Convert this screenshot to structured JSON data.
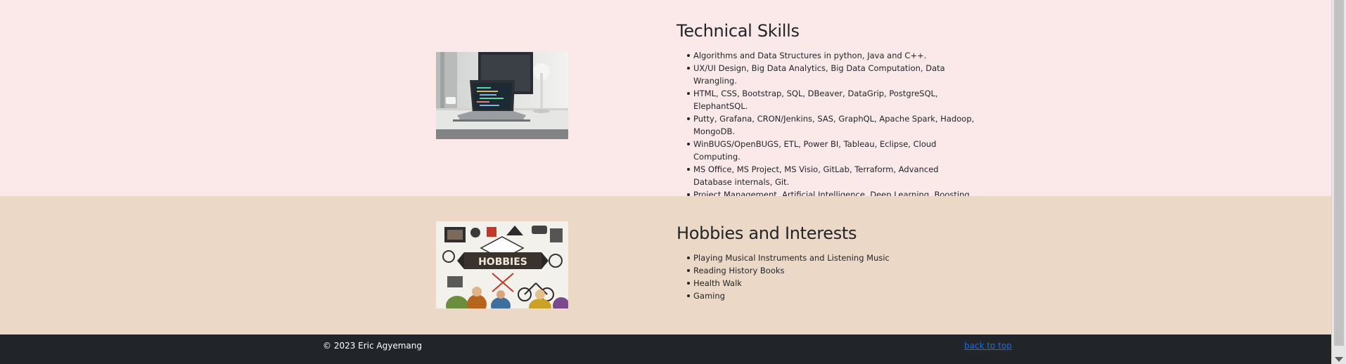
{
  "colors": {
    "skills_bg": "#fbe9e9",
    "hobbies_bg": "#ecd8c6",
    "footer_bg": "#212529",
    "link": "#0d6efd"
  },
  "skills": {
    "title": "Technical Skills",
    "image_icon": "laptop-desk-photo",
    "items": [
      "Algorithms and Data Structures in python, Java and C++.",
      "UX/UI Design, Big Data Analytics, Big Data Computation, Data Wrangling.",
      "HTML, CSS, Bootstrap, SQL, DBeaver, DataGrip, PostgreSQL, ElephantSQL.",
      "Putty, Grafana, CRON/Jenkins, SAS, GraphQL, Apache Spark, Hadoop, MongoDB.",
      "WinBUGS/OpenBUGS, ETL, Power BI, Tableau, Eclipse, Cloud Computing.",
      "MS Office, MS Project, MS Visio, GitLab, Terraform, Advanced Database internals, Git.",
      "Project Management, Artificial Intelligence, Deep Learning, Boosting."
    ]
  },
  "hobbies": {
    "title": "Hobbies and Interests",
    "image_text": "HOBBIES",
    "items": [
      "Playing Musical Instruments and Listening Music",
      "Reading History Books",
      "Health Walk",
      "Gaming"
    ]
  },
  "footer": {
    "copyright": "© 2023 Eric Agyemang",
    "back_to_top": "back to top"
  }
}
